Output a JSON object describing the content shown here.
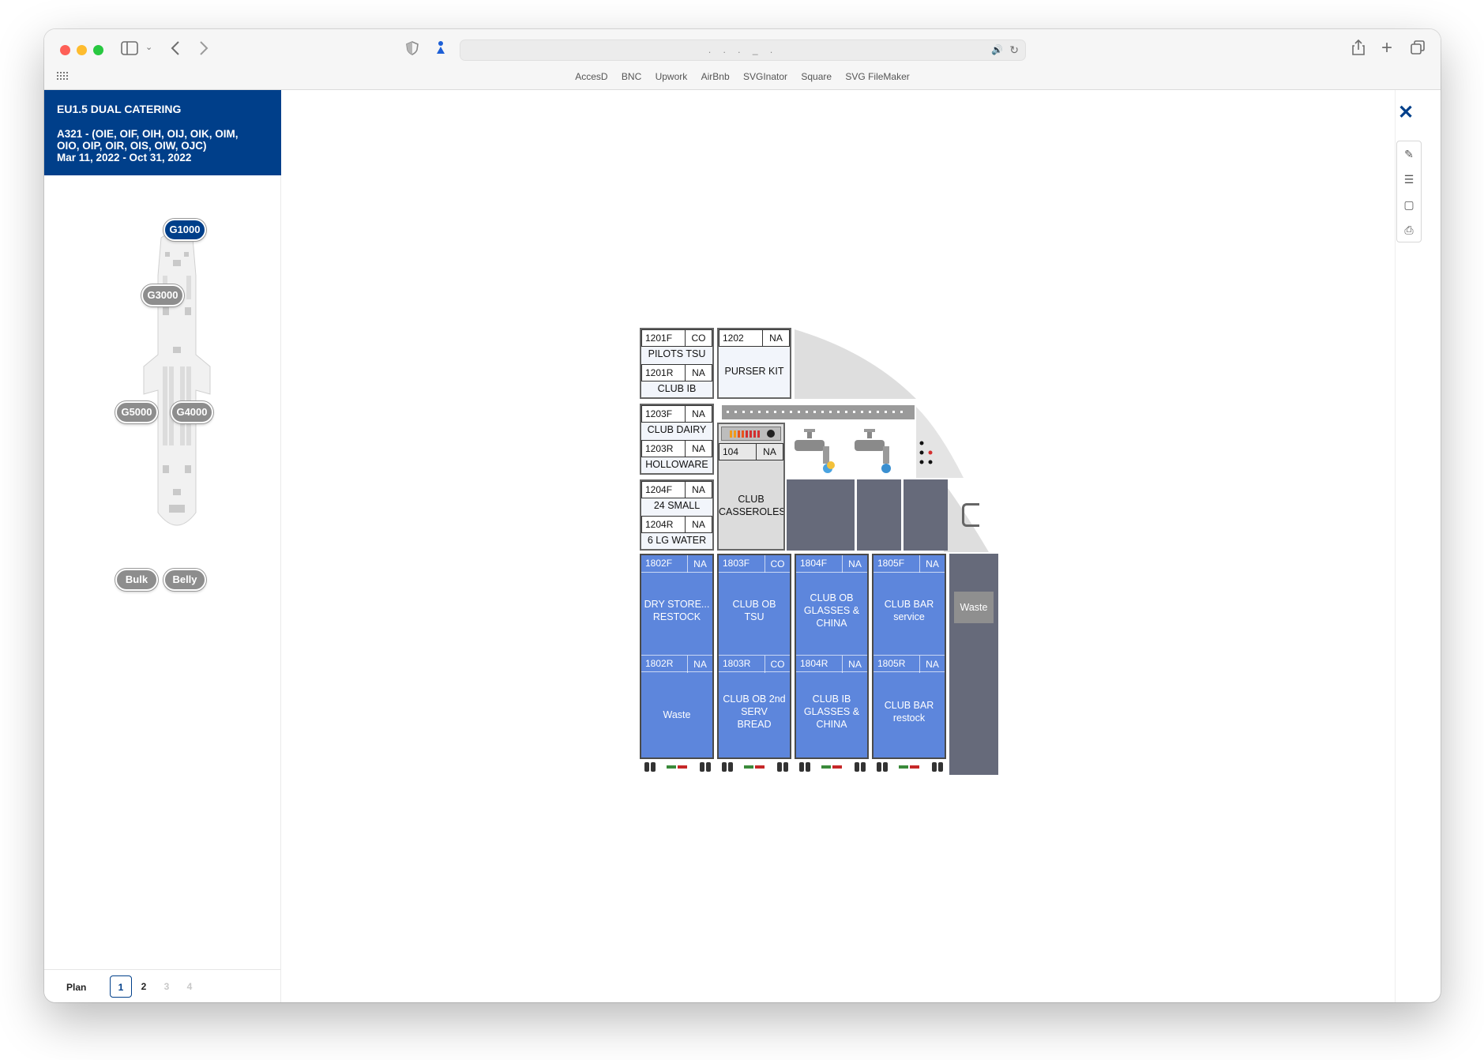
{
  "browser": {
    "bookmarks": [
      "AccesD",
      "BNC",
      "Upwork",
      "AirBnb",
      "SVGInator",
      "Square",
      "SVG FileMaker"
    ],
    "url_hint": ". . . _ ."
  },
  "header": {
    "title": "EU1.5 DUAL CATERING",
    "line1": "A321 - (OIE, OIF, OIH, OIJ, OIK, OIM,",
    "line2": "OIO, OIP, OIR, OIS, OIW, OJC)",
    "line3": "Mar 11, 2022 - Oct 31, 2022"
  },
  "galley_selector": {
    "g1000": "G1000",
    "g3000": "G3000",
    "g5000": "G5000",
    "g4000": "G4000",
    "bulk": "Bulk",
    "belly": "Belly"
  },
  "footer": {
    "plan": "Plan",
    "pages": [
      "1",
      "2",
      "3",
      "4"
    ],
    "current_page": "1"
  },
  "stowage": {
    "top_left": [
      {
        "code": "1201F",
        "status": "CO",
        "label": "PILOTS TSU"
      },
      {
        "code": "1201R",
        "status": "NA",
        "label": "CLUB IB"
      },
      {
        "code": "1203F",
        "status": "NA",
        "label": "CLUB DAIRY"
      },
      {
        "code": "1203R",
        "status": "NA",
        "label": "HOLLOWARE"
      },
      {
        "code": "1204F",
        "status": "NA",
        "label": "24 SMALL"
      },
      {
        "code": "1204R",
        "status": "NA",
        "label": "6 LG WATER"
      }
    ],
    "purser": {
      "code": "1202",
      "status": "NA",
      "label": "PURSER KIT"
    },
    "oven": {
      "code": "104",
      "status": "NA",
      "label_line1": "CLUB",
      "label_line2": "CASSEROLES"
    },
    "carts": [
      {
        "f_code": "1802F",
        "f_status": "NA",
        "f_label": [
          "DRY STORE...",
          "RESTOCK"
        ],
        "r_code": "1802R",
        "r_status": "NA",
        "r_label": [
          "Waste"
        ]
      },
      {
        "f_code": "1803F",
        "f_status": "CO",
        "f_label": [
          "CLUB OB",
          "TSU"
        ],
        "r_code": "1803R",
        "r_status": "CO",
        "r_label": [
          "CLUB OB 2nd",
          "SERV",
          "BREAD"
        ]
      },
      {
        "f_code": "1804F",
        "f_status": "NA",
        "f_label": [
          "CLUB OB",
          "GLASSES &",
          "CHINA"
        ],
        "r_code": "1804R",
        "r_status": "NA",
        "r_label": [
          "CLUB IB",
          "GLASSES &",
          "CHINA"
        ]
      },
      {
        "f_code": "1805F",
        "f_status": "NA",
        "f_label": [
          "CLUB BAR",
          "service"
        ],
        "r_code": "1805R",
        "r_status": "NA",
        "r_label": [
          "CLUB BAR",
          "restock"
        ]
      }
    ],
    "waste": "Waste"
  },
  "colors": {
    "brand": "#003f8a",
    "cart": "#5d86dc",
    "dark_panel": "#666a7a",
    "pill_inactive": "#8d8d8d"
  }
}
